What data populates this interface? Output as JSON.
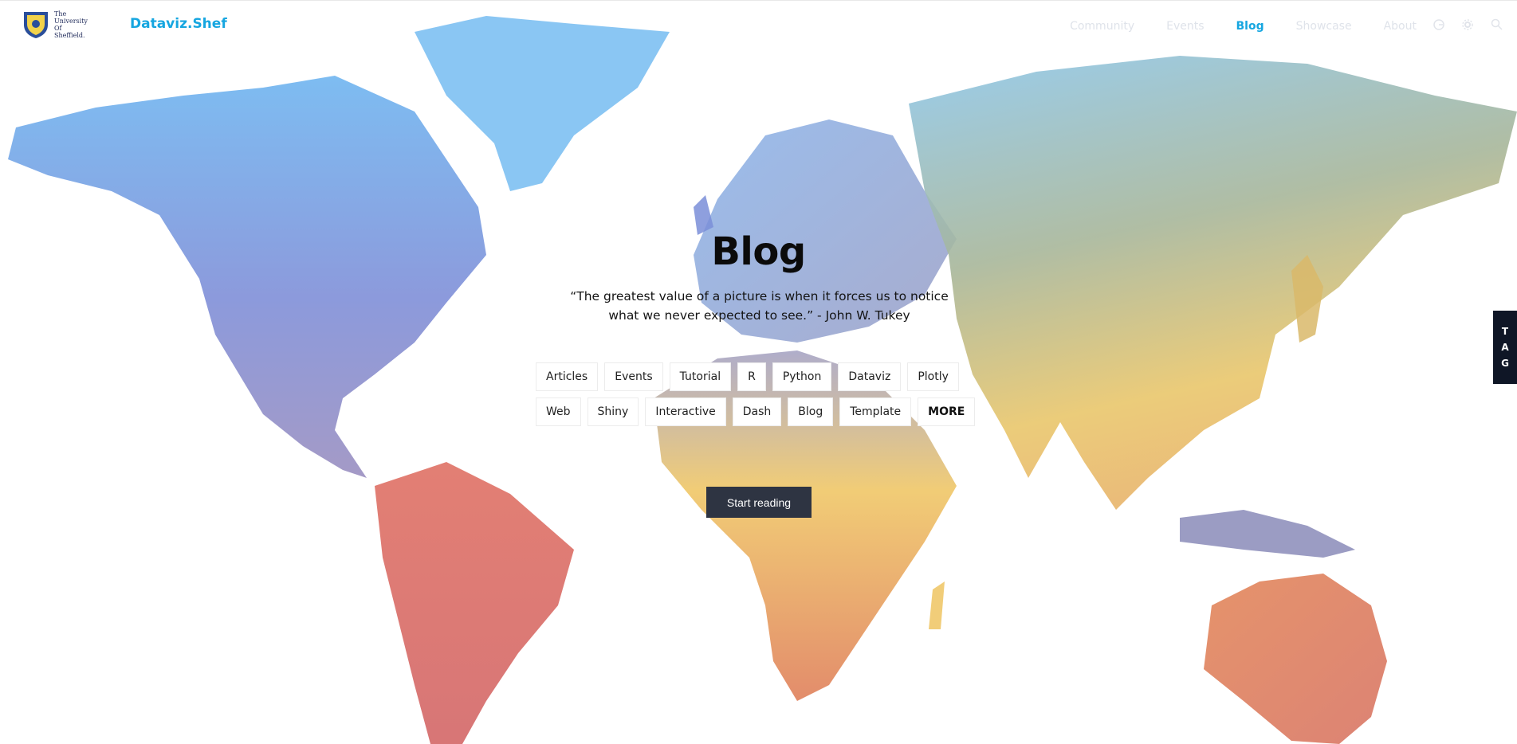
{
  "header": {
    "logo_text": [
      "The",
      "University",
      "Of",
      "Sheffield."
    ],
    "brand": "Dataviz.Shef",
    "nav": [
      "Community",
      "Events",
      "Blog",
      "Showcase",
      "About"
    ],
    "active_nav": "Blog",
    "icons": [
      "github-icon",
      "gear-icon",
      "search-icon"
    ]
  },
  "hero": {
    "title": "Blog",
    "quote_line1": "“The greatest value of a picture is when it forces us to notice",
    "quote_line2": "what we never expected to see.” - John W. Tukey"
  },
  "tags": {
    "row1": [
      "Articles",
      "Events",
      "Tutorial",
      "R",
      "Python",
      "Dataviz",
      "Plotly"
    ],
    "row2": [
      "Web",
      "Shiny",
      "Interactive",
      "Dash",
      "Blog",
      "Template",
      "MORE"
    ]
  },
  "cta": {
    "label": "Start reading"
  },
  "side_tab": {
    "letters": [
      "T",
      "A",
      "G"
    ]
  },
  "colors": {
    "accent": "#16a6e0",
    "button_bg": "#2e3442",
    "side_tab_bg": "#0f1626"
  }
}
